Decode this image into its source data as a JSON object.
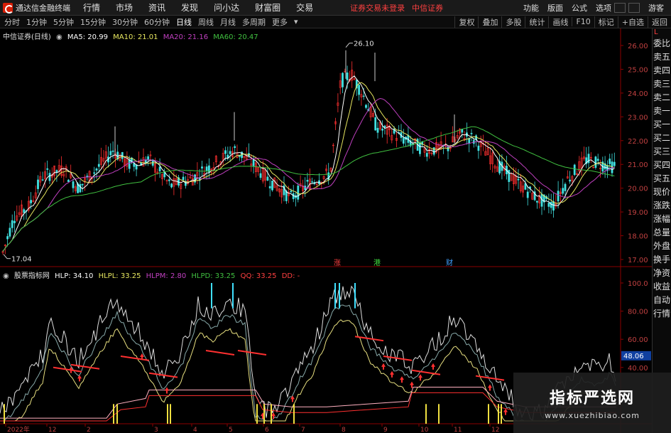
{
  "menubar": {
    "title": "通达信金融终端",
    "items": [
      "行情",
      "市场",
      "资讯",
      "发现",
      "问小达",
      "财富圈",
      "交易"
    ],
    "login_status": "证券交易未登录",
    "broker": "中信证券",
    "right_items": [
      "功能",
      "版面",
      "公式",
      "选项"
    ],
    "guest": "游客"
  },
  "toolbar": {
    "periods": [
      "分时",
      "1分钟",
      "5分钟",
      "15分钟",
      "30分钟",
      "60分钟",
      "日线",
      "周线",
      "月线",
      "多周期",
      "更多"
    ],
    "active_period": "日线",
    "right_items": [
      "复权",
      "叠加",
      "多股",
      "统计",
      "画线",
      "F10",
      "标记",
      "+自选",
      "返回"
    ]
  },
  "main_chart": {
    "stock": "中信证券(日线)",
    "ma5": "MA5: 20.99",
    "ma10": "MA10: 21.01",
    "ma20": "MA20: 21.16",
    "ma60": "MA60: 20.47",
    "high_label": "26.10",
    "low_label": "17.04",
    "y_ticks": [
      "26.00",
      "25.00",
      "24.00",
      "23.00",
      "22.00",
      "21.00",
      "20.00",
      "19.00",
      "18.00",
      "17.00"
    ],
    "events": [
      "涨",
      "港",
      "财"
    ],
    "colors": {
      "ma5": "#ffffff",
      "ma10": "#e8e860",
      "ma20": "#c040c0",
      "ma60": "#40c040",
      "up": "#ff3030",
      "down": "#40e0e0"
    }
  },
  "indicator": {
    "name": "股票指标网",
    "hlp": "HLP: 34.10",
    "hlpl": "HLPL: 33.25",
    "hlpm": "HLPM: 2.80",
    "hlpd": "HLPD: 33.25",
    "qq": "QQ: 33.25",
    "dd": "DD: -",
    "y_ticks": [
      "100.0",
      "80.00",
      "60.00",
      "40.00"
    ],
    "current_value": "48.06"
  },
  "x_axis": {
    "labels": [
      "2022年",
      "12",
      "2",
      "3",
      "4",
      "5",
      "6",
      "7",
      "8",
      "9",
      "10",
      "11",
      "12"
    ]
  },
  "sidepanel": {
    "marker": "L",
    "items": [
      "委比",
      "卖五",
      "卖四",
      "卖三",
      "卖二",
      "卖一",
      "买一",
      "买二",
      "买三",
      "买四",
      "买五",
      "现价",
      "涨跌",
      "涨幅",
      "总量",
      "外盘",
      "换手",
      "净资",
      "收益",
      "自动",
      "行情"
    ]
  },
  "watermark": {
    "title": "指标严选网",
    "url": "www.xuezhibiao.com"
  }
}
